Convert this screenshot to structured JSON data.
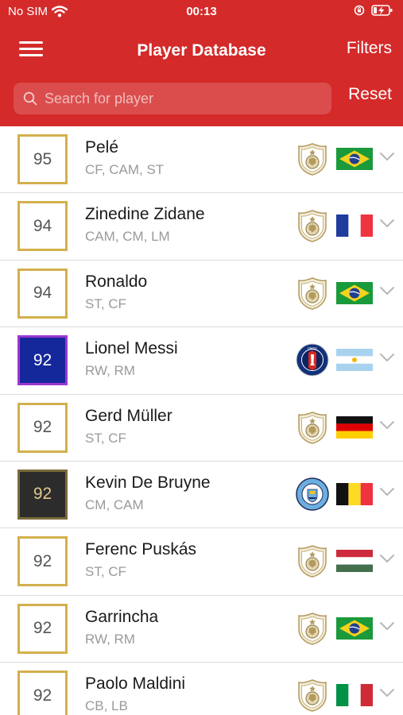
{
  "status_bar": {
    "carrier": "No SIM",
    "time": "00:13"
  },
  "nav": {
    "title": "Player Database",
    "filters_label": "Filters"
  },
  "search": {
    "placeholder": "Search for player",
    "value": "",
    "reset_label": "Reset"
  },
  "colors": {
    "header": "#d42a2a",
    "gold_border": "#d3b04d",
    "psg_blue": "#14279b",
    "card_dark": "#2c2c2c"
  },
  "players": [
    {
      "rating": "95",
      "name": "Pelé",
      "positions": "CF, CAM, ST",
      "card": "gold",
      "club": "icon-badge",
      "flag": "brazil"
    },
    {
      "rating": "94",
      "name": "Zinedine Zidane",
      "positions": "CAM, CM, LM",
      "card": "gold",
      "club": "icon-badge",
      "flag": "france"
    },
    {
      "rating": "94",
      "name": "Ronaldo",
      "positions": "ST, CF",
      "card": "gold",
      "club": "icon-badge",
      "flag": "brazil"
    },
    {
      "rating": "92",
      "name": "Lionel Messi",
      "positions": "RW, RM",
      "card": "psg",
      "club": "psg-badge",
      "flag": "argentina"
    },
    {
      "rating": "92",
      "name": "Gerd Müller",
      "positions": "ST, CF",
      "card": "gold",
      "club": "icon-badge",
      "flag": "germany"
    },
    {
      "rating": "92",
      "name": "Kevin De Bruyne",
      "positions": "CM, CAM",
      "card": "dark",
      "club": "man-city-badge",
      "flag": "belgium"
    },
    {
      "rating": "92",
      "name": "Ferenc Puskás",
      "positions": "ST, CF",
      "card": "gold",
      "club": "icon-badge",
      "flag": "hungary"
    },
    {
      "rating": "92",
      "name": "Garrincha",
      "positions": "RW, RM",
      "card": "gold",
      "club": "icon-badge",
      "flag": "brazil"
    },
    {
      "rating": "92",
      "name": "Paolo Maldini",
      "positions": "CB, LB",
      "card": "gold",
      "club": "icon-badge",
      "flag": "italy"
    }
  ]
}
